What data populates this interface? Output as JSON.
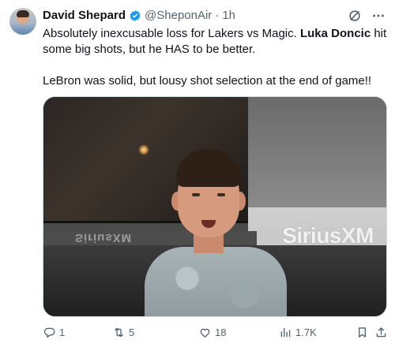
{
  "author": {
    "name": "David Shepard",
    "handle": "@SheponAir",
    "separator": "·",
    "time": "1h"
  },
  "tweet": {
    "line1_part1": "Absolutely inexcusable loss for Lakers vs Magic. ",
    "line1_bold": "Luka Doncic",
    "line1_part2": " hit some big shots, but he HAS to be better.",
    "line2": "LeBron was solid, but lousy shot selection at the end of game!!"
  },
  "media": {
    "logo_text": "SiriusXM",
    "desk_text": "SiriusXM"
  },
  "actions": {
    "replies": "1",
    "reposts": "5",
    "likes": "18",
    "views": "1.7K"
  },
  "colors": {
    "verified": "#1d9bf0",
    "muted": "#536471",
    "text": "#0f1419"
  },
  "icons": {
    "verified": "verified-badge-icon",
    "grok": "grok-icon",
    "more": "more-icon",
    "reply": "reply-icon",
    "repost": "repost-icon",
    "like": "heart-icon",
    "views": "views-icon",
    "bookmark": "bookmark-icon",
    "share": "share-icon"
  }
}
